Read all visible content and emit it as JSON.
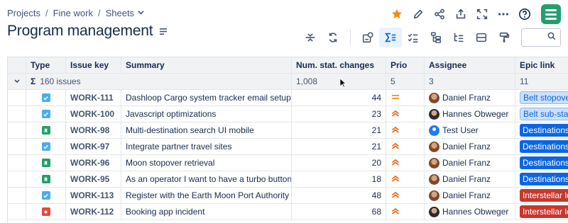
{
  "breadcrumb": {
    "items": [
      "Projects",
      "Fine work",
      "Sheets"
    ],
    "separator": "/"
  },
  "page": {
    "title": "Program management"
  },
  "colors": {
    "accent": "#0c66e4",
    "star": "#f18d13",
    "app_logo": "#22a06b",
    "prio_medium": "#f18d13",
    "prio_high": "#e56910"
  },
  "top_icons": [
    "star-icon",
    "edit-icon",
    "share-icon",
    "export-icon",
    "fullscreen-icon",
    "more-icon",
    "help-icon",
    "app-logo-icon"
  ],
  "toolbar": {
    "icons": [
      "collapse-rows-icon",
      "refresh-icon",
      "structure-icon",
      "sum-icon",
      "checklist-icon",
      "hierarchy-icon",
      "transform-icon",
      "view-icon",
      "format-painter-icon",
      "search-icon"
    ],
    "active": "sum-icon",
    "search_value": ""
  },
  "table": {
    "columns": [
      "Type",
      "Issue key",
      "Summary",
      "Num. stat. changes",
      "Prio",
      "Assignee",
      "Epic link"
    ],
    "summary_row": {
      "toggle": "⌄",
      "sigma": "Σ",
      "label": "160 issues",
      "stat_changes": "1,008",
      "prio": "5",
      "assignee": "3",
      "epic": "11"
    },
    "rows": [
      {
        "type": "task",
        "key": "WORK-111",
        "summary": "Dashloop Cargo system tracker email setup",
        "changes": "44",
        "prio": "medium",
        "assignee": "Daniel Franz",
        "avatar": "df",
        "epic": "Belt stopover",
        "epic_style": "light"
      },
      {
        "type": "task",
        "key": "WORK-100",
        "summary": "Javascript optimizations",
        "changes": "23",
        "prio": "high",
        "assignee": "Hannes Obweger",
        "avatar": "ho",
        "epic": "Belt sub-stati",
        "epic_style": "light"
      },
      {
        "type": "story",
        "key": "WORK-98",
        "summary": "Multi-destination search UI mobile",
        "changes": "21",
        "prio": "high",
        "assignee": "Test User",
        "avatar": "tu",
        "epic": "Destinations",
        "epic_style": "blue"
      },
      {
        "type": "task",
        "key": "WORK-97",
        "summary": "Integrate partner travel sites",
        "changes": "21",
        "prio": "high",
        "assignee": "Daniel Franz",
        "avatar": "df",
        "epic": "Destinations",
        "epic_style": "blue"
      },
      {
        "type": "story",
        "key": "WORK-96",
        "summary": "Moon stopover retrieval",
        "changes": "20",
        "prio": "high",
        "assignee": "Daniel Franz",
        "avatar": "df",
        "epic": "Destinations",
        "epic_style": "blue"
      },
      {
        "type": "story",
        "key": "WORK-95",
        "summary": "As an operator I want to have a turbo button",
        "changes": "18",
        "prio": "high",
        "assignee": "Daniel Franz",
        "avatar": "df",
        "epic": "Destinations",
        "epic_style": "blue"
      },
      {
        "type": "task",
        "key": "WORK-113",
        "summary": "Register with the Earth Moon Port Authority",
        "changes": "48",
        "prio": "high",
        "assignee": "Daniel Franz",
        "avatar": "df",
        "epic": "Interstellar lo",
        "epic_style": "red"
      },
      {
        "type": "bug",
        "key": "WORK-112",
        "summary": "Booking app incident",
        "changes": "68",
        "prio": "high",
        "assignee": "Hannes Obweger",
        "avatar": "ho",
        "epic": "Interstellar lo",
        "epic_style": "red"
      }
    ]
  }
}
